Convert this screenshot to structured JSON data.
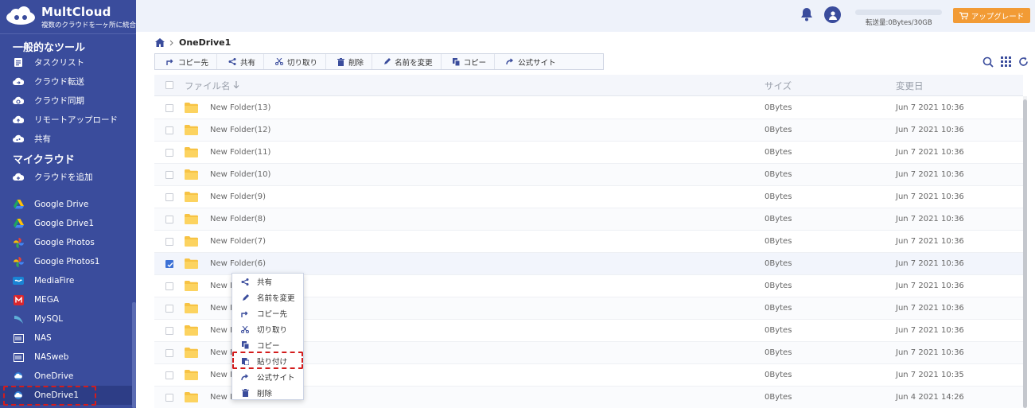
{
  "brand": {
    "name": "MultCloud",
    "tagline": "複数のクラウドを一ヶ所に統合"
  },
  "sidebar": {
    "section_tools": "一般的なツール",
    "tools": [
      {
        "label": "タスクリスト",
        "icon": "task-list-icon"
      },
      {
        "label": "クラウド転送",
        "icon": "cloud-transfer-icon"
      },
      {
        "label": "クラウド同期",
        "icon": "cloud-sync-icon"
      },
      {
        "label": "リモートアップロード",
        "icon": "remote-upload-icon"
      },
      {
        "label": "共有",
        "icon": "share-cloud-icon"
      }
    ],
    "section_clouds": "マイクラウド",
    "add_cloud": "クラウドを追加",
    "clouds": [
      {
        "label": "Google Drive",
        "icon": "google-drive-icon"
      },
      {
        "label": "Google Drive1",
        "icon": "google-drive-icon"
      },
      {
        "label": "Google Photos",
        "icon": "google-photos-icon"
      },
      {
        "label": "Google Photos1",
        "icon": "google-photos-icon"
      },
      {
        "label": "MediaFire",
        "icon": "mediafire-icon"
      },
      {
        "label": "MEGA",
        "icon": "mega-icon"
      },
      {
        "label": "MySQL",
        "icon": "mysql-icon"
      },
      {
        "label": "NAS",
        "icon": "nas-icon"
      },
      {
        "label": "NASweb",
        "icon": "nas-icon"
      },
      {
        "label": "OneDrive",
        "icon": "onedrive-icon"
      },
      {
        "label": "OneDrive1",
        "icon": "onedrive-icon"
      }
    ],
    "active": "OneDrive1"
  },
  "header": {
    "quota": "転送量:0Bytes/30GB",
    "upgrade": "アップグレード"
  },
  "breadcrumb": {
    "current": "OneDrive1"
  },
  "toolbar": [
    "コピー先",
    "共有",
    "切り取り",
    "削除",
    "名前を変更",
    "コピー",
    "公式サイト"
  ],
  "table": {
    "columns": {
      "name": "ファイル名",
      "size": "サイズ",
      "date": "変更日"
    },
    "rows": [
      {
        "name": "New Folder(13)",
        "size": "0Bytes",
        "date": "Jun 7 2021 10:36",
        "checked": false
      },
      {
        "name": "New Folder(12)",
        "size": "0Bytes",
        "date": "Jun 7 2021 10:36",
        "checked": false
      },
      {
        "name": "New Folder(11)",
        "size": "0Bytes",
        "date": "Jun 7 2021 10:36",
        "checked": false
      },
      {
        "name": "New Folder(10)",
        "size": "0Bytes",
        "date": "Jun 7 2021 10:36",
        "checked": false
      },
      {
        "name": "New Folder(9)",
        "size": "0Bytes",
        "date": "Jun 7 2021 10:36",
        "checked": false
      },
      {
        "name": "New Folder(8)",
        "size": "0Bytes",
        "date": "Jun 7 2021 10:36",
        "checked": false
      },
      {
        "name": "New Folder(7)",
        "size": "0Bytes",
        "date": "Jun 7 2021 10:36",
        "checked": false
      },
      {
        "name": "New Folder(6)",
        "size": "0Bytes",
        "date": "Jun 7 2021 10:36",
        "checked": true
      },
      {
        "name": "New F",
        "size": "0Bytes",
        "date": "Jun 7 2021 10:36",
        "checked": false
      },
      {
        "name": "New F",
        "size": "0Bytes",
        "date": "Jun 7 2021 10:36",
        "checked": false
      },
      {
        "name": "New F",
        "size": "0Bytes",
        "date": "Jun 7 2021 10:36",
        "checked": false
      },
      {
        "name": "New F",
        "size": "0Bytes",
        "date": "Jun 7 2021 10:36",
        "checked": false
      },
      {
        "name": "New F",
        "size": "0Bytes",
        "date": "Jun 7 2021 10:35",
        "checked": false
      },
      {
        "name": "New Folder",
        "size": "0Bytes",
        "date": "Jun 4 2021 14:26",
        "checked": false
      }
    ]
  },
  "context_menu": [
    {
      "label": "共有",
      "icon": "share-icon"
    },
    {
      "label": "名前を変更",
      "icon": "pencil-icon"
    },
    {
      "label": "コピー先",
      "icon": "copy-to-icon"
    },
    {
      "label": "切り取り",
      "icon": "scissors-icon"
    },
    {
      "label": "コピー",
      "icon": "copy-icon"
    },
    {
      "label": "貼り付け",
      "icon": "paste-icon"
    },
    {
      "label": "公式サイト",
      "icon": "external-link-icon"
    },
    {
      "label": "削除",
      "icon": "trash-icon"
    }
  ],
  "colors": {
    "sidebar": "#3a4c9c",
    "accent": "#3d72d6",
    "upgrade": "#f29b35",
    "highlight": "#d31c1c"
  }
}
